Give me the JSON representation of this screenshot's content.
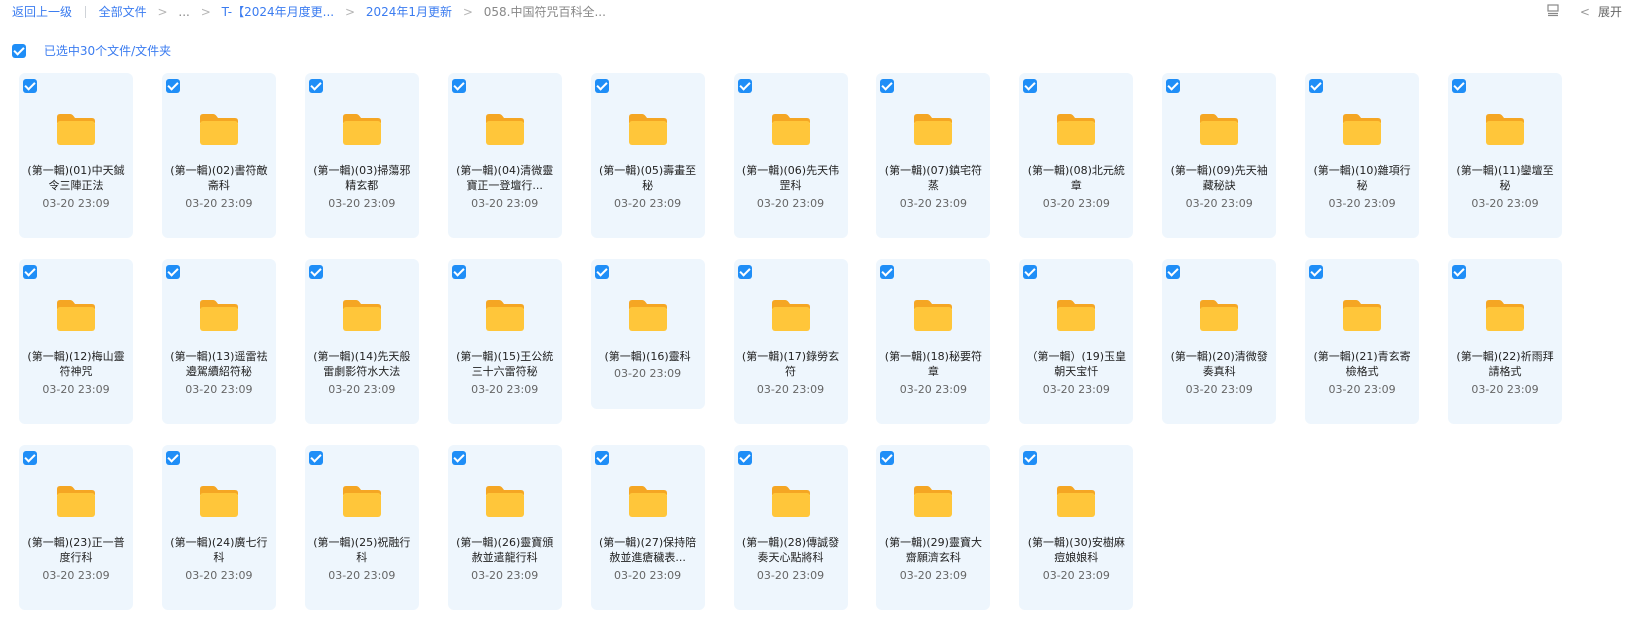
{
  "breadcrumb": {
    "back": "返回上一级",
    "all_files": "全部文件",
    "ellipsis": "...",
    "level1": "T-【2024年月度更...",
    "level2": "2024年1月更新",
    "current": "058.中国符咒百科全..."
  },
  "toolbar": {
    "expand_label": "展开"
  },
  "selection": {
    "text": "已选中30个文件/文件夹"
  },
  "folders": [
    {
      "name": "(第一輯)(01)中天鋮令三陣正法",
      "date": "03-20 23:09"
    },
    {
      "name": "(第一輯)(02)書符敵斋科",
      "date": "03-20 23:09"
    },
    {
      "name": "(第一輯)(03)掃蕩邪精玄都",
      "date": "03-20 23:09"
    },
    {
      "name": "(第一輯)(04)清微靈寶正一登壇行...",
      "date": "03-20 23:09"
    },
    {
      "name": "(第一輯)(05)壽畫至秘",
      "date": "03-20 23:09"
    },
    {
      "name": "(第一輯)(06)先天伟罡科",
      "date": "03-20 23:09"
    },
    {
      "name": "(第一輯)(07)鎮宅符蒸",
      "date": "03-20 23:09"
    },
    {
      "name": "(第一輯)(08)北元統章",
      "date": "03-20 23:09"
    },
    {
      "name": "(第一輯)(09)先天袖藏秘訣",
      "date": "03-20 23:09"
    },
    {
      "name": "(第一輯)(10)雜項行秘",
      "date": "03-20 23:09"
    },
    {
      "name": "(第一輯)(11)鑾壇至秘",
      "date": "03-20 23:09"
    },
    {
      "name": "(第一輯)(12)梅山靈符神咒",
      "date": "03-20 23:09"
    },
    {
      "name": "(第一輯)(13)遥雷祛邉駕續紹符秘",
      "date": "03-20 23:09"
    },
    {
      "name": "(第一輯)(14)先天般雷劇影符水大法",
      "date": "03-20 23:09"
    },
    {
      "name": "(第一輯)(15)王公統三十六雷符秘",
      "date": "03-20 23:09"
    },
    {
      "name": "(第一輯)(16)靈科",
      "date": "03-20 23:09",
      "short": true
    },
    {
      "name": "(第一輯)(17)錄勞玄符",
      "date": "03-20 23:09"
    },
    {
      "name": "(第一輯)(18)秘要符章",
      "date": "03-20 23:09"
    },
    {
      "name": "（第一輯）(19)玉皇朝天宝忏",
      "date": "03-20 23:09"
    },
    {
      "name": "(第一輯)(20)清微發奏真科",
      "date": "03-20 23:09"
    },
    {
      "name": "(第一輯)(21)青玄寄檢格式",
      "date": "03-20 23:09"
    },
    {
      "name": "(第一輯)(22)祈雨拜請格式",
      "date": "03-20 23:09"
    },
    {
      "name": "(第一輯)(23)正一普度行科",
      "date": "03-20 23:09"
    },
    {
      "name": "(第一輯)(24)廣七行科",
      "date": "03-20 23:09"
    },
    {
      "name": "(第一輯)(25)祝融行科",
      "date": "03-20 23:09"
    },
    {
      "name": "(第一輯)(26)靈寶頒赦並遣龍行科",
      "date": "03-20 23:09"
    },
    {
      "name": "(第一輯)(27)保持陪赦並進瘡穢表...",
      "date": "03-20 23:09"
    },
    {
      "name": "(第一輯)(28)傳誠發奏天心點將科",
      "date": "03-20 23:09"
    },
    {
      "name": "(第一輯)(29)靈寶大齋願濟玄科",
      "date": "03-20 23:09"
    },
    {
      "name": "(第一輯)(30)安樹麻痘娘娘科",
      "date": "03-20 23:09"
    }
  ],
  "colors": {
    "accent": "#1f8ef7",
    "link": "#3b7cf0",
    "card_bg": "#eef6fd",
    "folder": "#ffc63a"
  },
  "icons": {
    "checkbox": "checkbox-checked-icon",
    "folder": "folder-icon",
    "list_view": "list-view-icon",
    "chevron": "chevron-left-icon"
  }
}
